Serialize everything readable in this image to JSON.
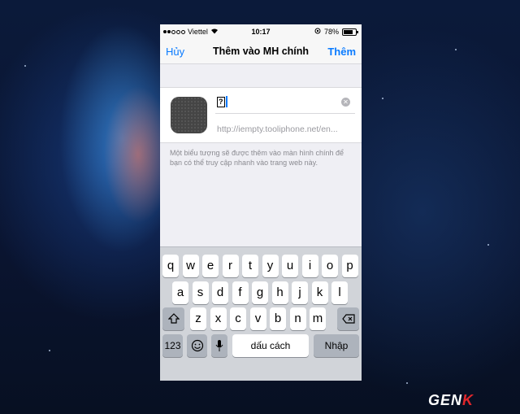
{
  "status_bar": {
    "carrier": "Viettel",
    "time": "10:17",
    "battery": "78%",
    "battery_level": 0.78
  },
  "nav": {
    "cancel": "Hủy",
    "title": "Thêm vào MH chính",
    "add": "Thêm"
  },
  "form": {
    "name_value": "?",
    "url": "http://iempty.tooliphone.net/en...",
    "description": "Một biểu tượng sẽ được thêm vào màn hình chính để bạn có thể truy cập nhanh vào trang web này."
  },
  "keyboard": {
    "row1": [
      "q",
      "w",
      "e",
      "r",
      "t",
      "y",
      "u",
      "i",
      "o",
      "p"
    ],
    "row2": [
      "a",
      "s",
      "d",
      "f",
      "g",
      "h",
      "j",
      "k",
      "l"
    ],
    "row3": [
      "z",
      "x",
      "c",
      "v",
      "b",
      "n",
      "m"
    ],
    "numbers": "123",
    "space": "dấu cách",
    "return": "Nhập"
  },
  "watermark": {
    "text_main": "GEN",
    "text_accent": "K"
  }
}
